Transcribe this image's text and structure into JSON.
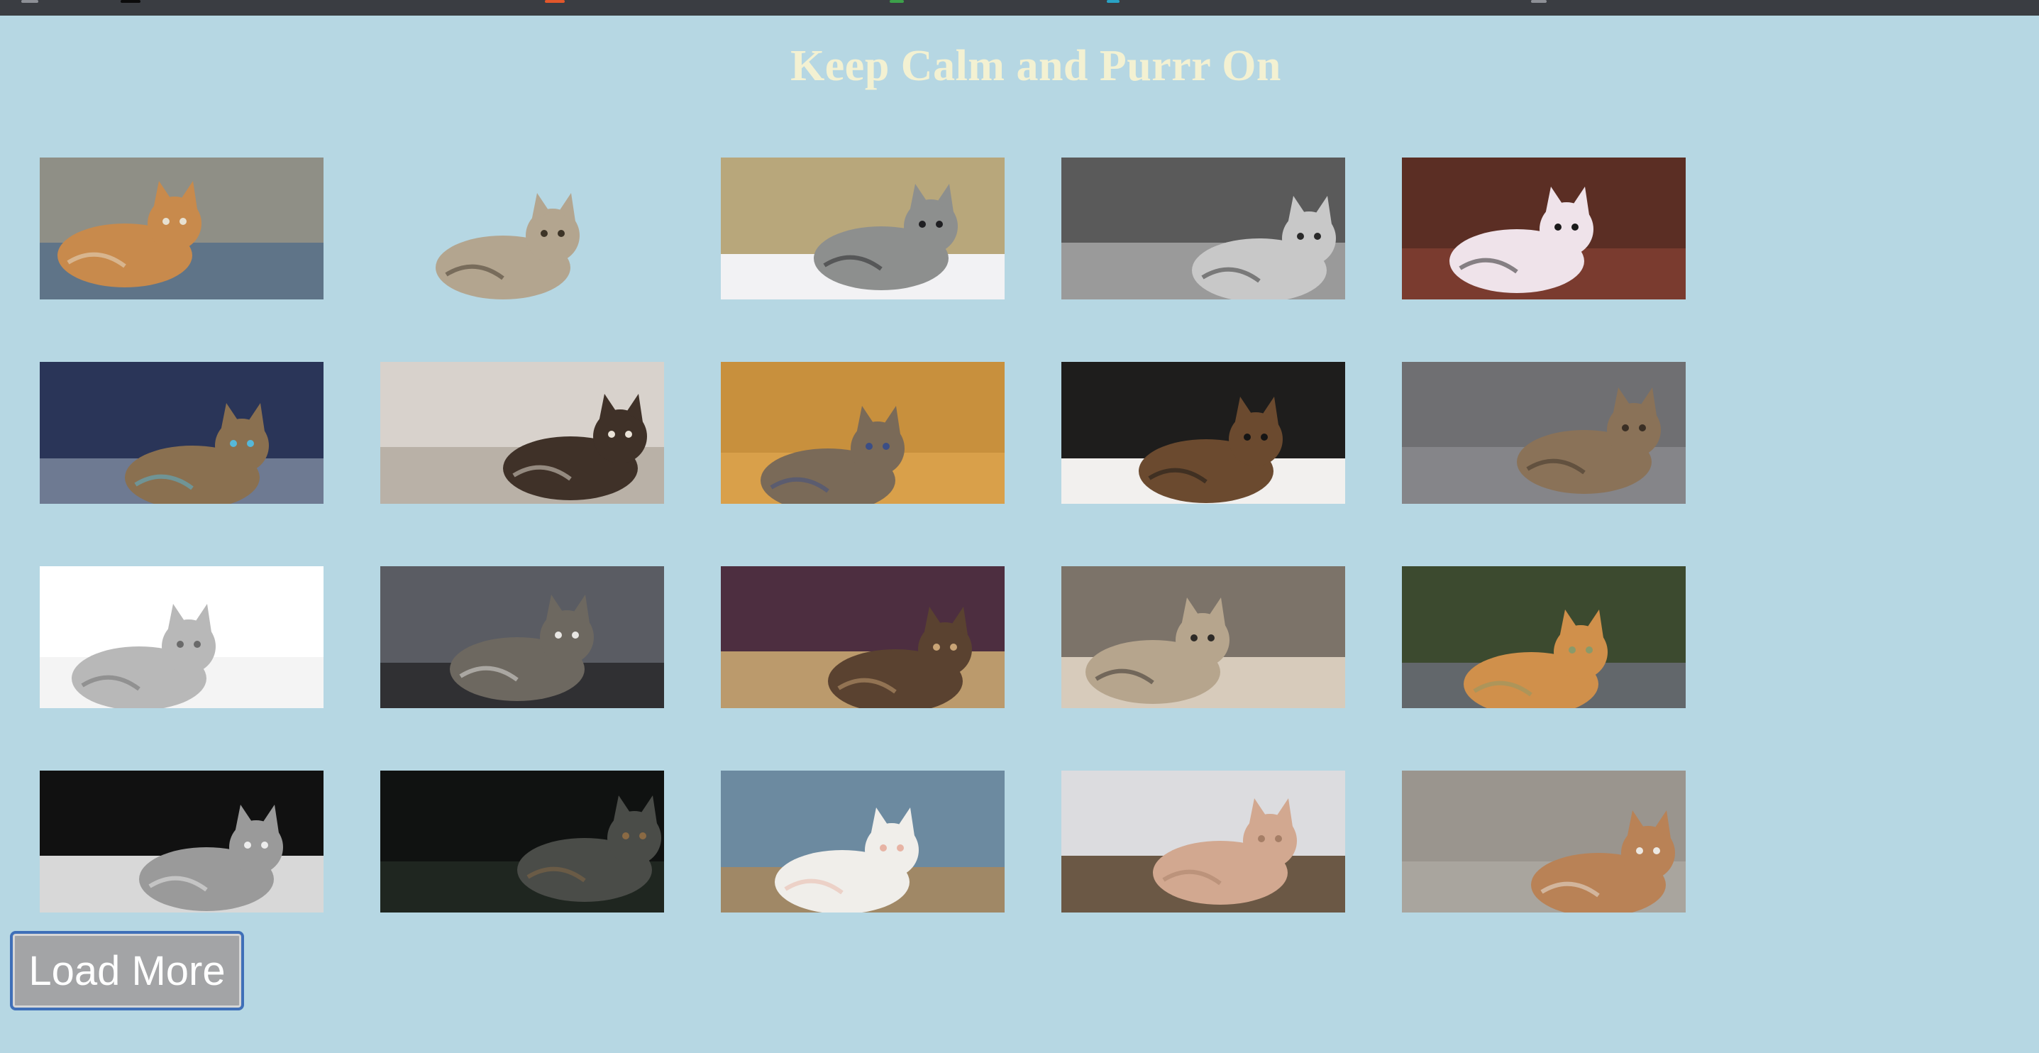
{
  "page": {
    "title": "Keep Calm and Purrr On",
    "load_more_label": "Load More"
  },
  "colors": {
    "background": "#b6d7e3",
    "title": "#f3f1d2",
    "button_bg": "#a3a4a6",
    "button_border": "#3f6fb8"
  },
  "gallery": {
    "photos": [
      {
        "name": "cat-photo-ginger-kitten-hallway",
        "bg": "#8f8f86",
        "floor": "#5f7488",
        "cat": "#c88a4c",
        "accent": "#e7e0d0"
      },
      {
        "name": "cat-photo-tabby-kitten-lying",
        "bg": "#b6d7e3",
        "floor": "#b6d7e3",
        "cat": "#b3a58f",
        "accent": "#3d3427"
      },
      {
        "name": "cat-photo-grey-cat-hairbrush",
        "bg": "#b8a77b",
        "floor": "#f2f2f4",
        "cat": "#8d8f8e",
        "accent": "#1f1f22"
      },
      {
        "name": "cat-photo-bw-cat-belly-up",
        "bg": "#5a5a5a",
        "floor": "#9a9a9a",
        "cat": "#c8c8c8",
        "accent": "#2a2a2a"
      },
      {
        "name": "cat-photo-calico-stretching",
        "bg": "#5b2e24",
        "floor": "#7a3b2f",
        "cat": "#efe3ea",
        "accent": "#1b1b1b"
      },
      {
        "name": "cat-photo-fluffy-kitten-bowl",
        "bg": "#2a3558",
        "floor": "#6e7a92",
        "cat": "#8a7050",
        "accent": "#55b8da"
      },
      {
        "name": "cat-photo-calico-green-eyes",
        "bg": "#d8d2cc",
        "floor": "#b9b1a7",
        "cat": "#3f3128",
        "accent": "#eae3d8"
      },
      {
        "name": "cat-photo-tabby-on-jeans",
        "bg": "#c8903d",
        "floor": "#d9a04a",
        "cat": "#7a6a58",
        "accent": "#3b4e86"
      },
      {
        "name": "cat-photo-tuxedo-lying",
        "bg": "#1e1d1c",
        "floor": "#f2f0ee",
        "cat": "#6b4a2f",
        "accent": "#151515"
      },
      {
        "name": "cat-photo-tabby-closeup",
        "bg": "#6f6f72",
        "floor": "#858589",
        "cat": "#8a7258",
        "accent": "#3a2f25"
      },
      {
        "name": "cat-photo-british-shorthair",
        "bg": "#ffffff",
        "floor": "#f4f4f4",
        "cat": "#b8b8b8",
        "accent": "#6a6a6a"
      },
      {
        "name": "cat-photo-tabby-white-lounging",
        "bg": "#5a5c63",
        "floor": "#303033",
        "cat": "#6d6860",
        "accent": "#e8e6e3"
      },
      {
        "name": "cat-photo-tortoiseshell-box",
        "bg": "#4d2e40",
        "floor": "#bb9a6c",
        "cat": "#5a4230",
        "accent": "#c9a476"
      },
      {
        "name": "cat-photo-paper-bag-hideout",
        "bg": "#7c7369",
        "floor": "#d7cbbb",
        "cat": "#b6a58d",
        "accent": "#2d2a27"
      },
      {
        "name": "cat-photo-ginger-longhair-outdoors",
        "bg": "#3c4a2f",
        "floor": "#62676b",
        "cat": "#d0904b",
        "accent": "#8a9a6a"
      },
      {
        "name": "cat-photo-cat-window-bw",
        "bg": "#111111",
        "floor": "#d8d8d8",
        "cat": "#9a9a9a",
        "accent": "#ededed"
      },
      {
        "name": "cat-photo-dark-tabby-glass",
        "bg": "#101211",
        "floor": "#1f2620",
        "cat": "#4a4c48",
        "accent": "#8a6a44"
      },
      {
        "name": "cat-photo-white-kitten-rug",
        "bg": "#6c8aa0",
        "floor": "#a08866",
        "cat": "#f0eeea",
        "accent": "#e7b3a4"
      },
      {
        "name": "cat-photo-paws-on-wood",
        "bg": "#dcdcdf",
        "floor": "#6b5845",
        "cat": "#d2a890",
        "accent": "#a57e66"
      },
      {
        "name": "cat-photo-ginger-white-walking",
        "bg": "#9a958e",
        "floor": "#a9a59e",
        "cat": "#b98256",
        "accent": "#ece8e2"
      }
    ]
  }
}
